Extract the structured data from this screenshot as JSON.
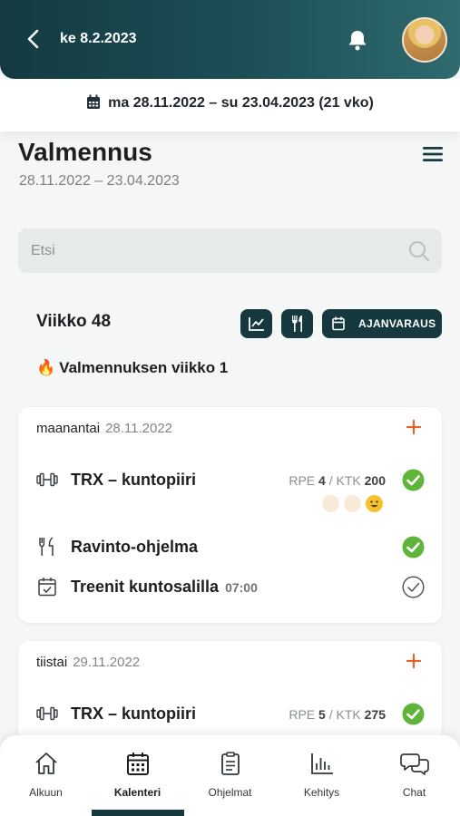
{
  "header": {
    "date": "ke 8.2.2023",
    "back_icon": "chevron-left-icon",
    "bell_icon": "bell-icon",
    "avatar": "user-avatar"
  },
  "range": {
    "text": "ma 28.11.2022 – su 23.04.2023 (21 vko)",
    "icon": "calendar-icon"
  },
  "page": {
    "title": "Valmennus",
    "subtitle": "28.11.2022 – 23.04.2023",
    "menu_icon": "hamburger-menu-icon"
  },
  "search": {
    "placeholder": "Etsi",
    "value": ""
  },
  "week": {
    "title": "Viikko 48",
    "note_icon": "🔥",
    "note": "Valmennuksen viikko 1",
    "buttons": {
      "chart_icon": "chart-icon",
      "nutrition_icon": "fork-knife-icon",
      "appointment_label": "AJANVARAUS"
    }
  },
  "days": [
    {
      "day": "maanantai",
      "date": "28.11.2022",
      "items": [
        {
          "icon": "dumbbell-icon",
          "name": "TRX – kuntopiiri",
          "rpe_label": "RPE",
          "rpe": "4",
          "ktk_label": "KTK",
          "ktk": "200",
          "status": "done"
        },
        {
          "icon": "fork-knife-icon",
          "name": "Ravinto-ohjelma",
          "status": "done"
        },
        {
          "icon": "calendar-check-icon",
          "name": "Treenit kuntosalilla",
          "time": "07:00",
          "status": "pending"
        }
      ]
    },
    {
      "day": "tiistai",
      "date": "29.11.2022",
      "items": [
        {
          "icon": "dumbbell-icon",
          "name": "TRX – kuntopiiri",
          "rpe_label": "RPE",
          "rpe": "5",
          "ktk_label": "KTK",
          "ktk": "275",
          "status": "done"
        }
      ]
    }
  ],
  "tabs": [
    {
      "label": "Alkuun",
      "icon": "home-icon"
    },
    {
      "label": "Kalenteri",
      "icon": "calendar-icon",
      "active": true
    },
    {
      "label": "Ohjelmat",
      "icon": "clipboard-icon"
    },
    {
      "label": "Kehitys",
      "icon": "bar-chart-icon"
    },
    {
      "label": "Chat",
      "icon": "chat-bubbles-icon"
    }
  ],
  "colors": {
    "primary": "#15393f",
    "accent": "#e0642b",
    "success": "#5fb53a"
  }
}
